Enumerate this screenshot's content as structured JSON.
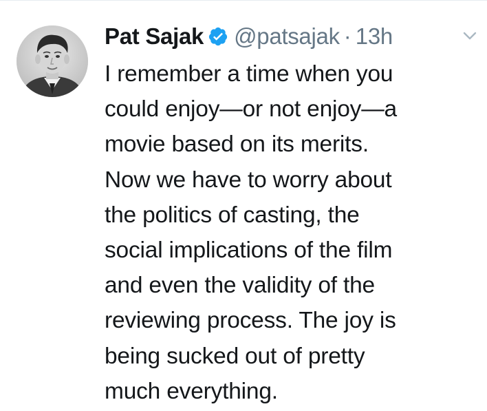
{
  "tweet": {
    "author": {
      "display_name": "Pat Sajak",
      "handle": "@patsajak",
      "verified": true,
      "avatar_icon": "profile-photo"
    },
    "separator": "·",
    "timestamp": "13h",
    "menu_icon": "chevron-down-icon",
    "text_lines": [
      "I remember a time when you",
      "could enjoy—or not enjoy—a",
      "movie based on its merits.",
      "Now we have to worry about",
      "the politics of casting, the",
      "social implications of the film",
      "and even the validity of the",
      "reviewing process. The joy is",
      "being sucked out of pretty",
      "much everything."
    ]
  },
  "colors": {
    "text": "#14171a",
    "secondary": "#657786",
    "verified_badge": "#1da1f2",
    "caret": "#aab8c2",
    "divider": "#e6ecf0"
  }
}
